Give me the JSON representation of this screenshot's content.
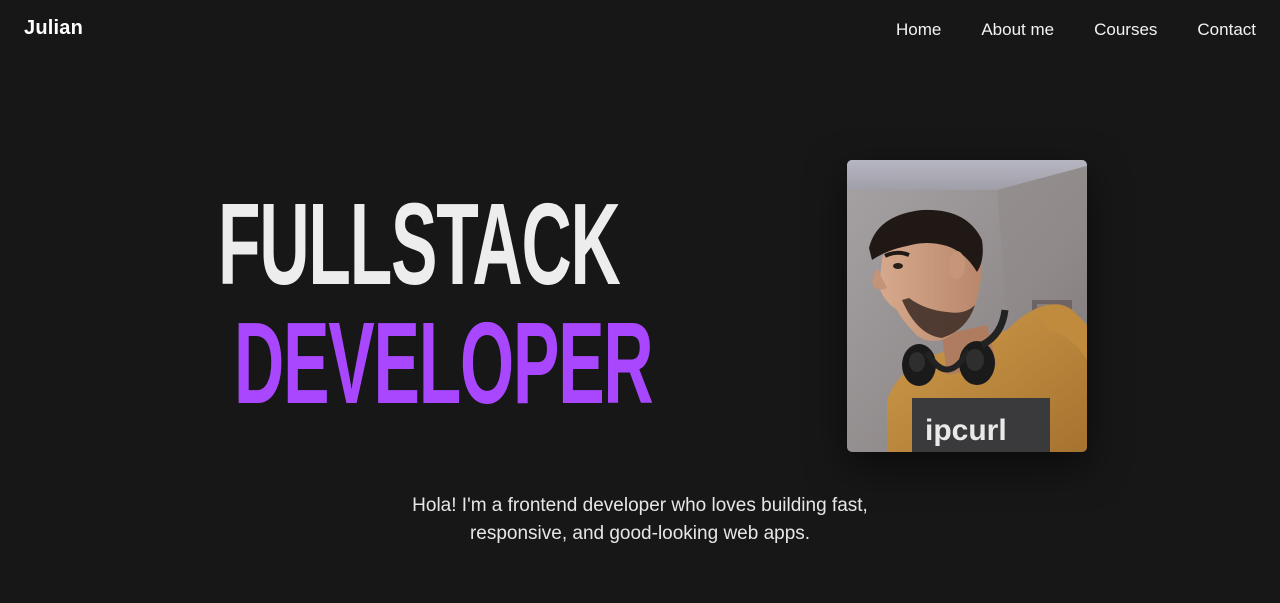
{
  "header": {
    "brand": "Julian",
    "nav": [
      {
        "label": "Home"
      },
      {
        "label": "About me"
      },
      {
        "label": "Courses"
      },
      {
        "label": "Contact"
      }
    ]
  },
  "hero": {
    "title_line_1": "FULLSTACK",
    "title_line_2": "DEVELOPER",
    "accent_color": "#a947ff",
    "intro_line_1": "Hola! I'm a frontend developer who loves building fast,",
    "intro_line_2": "responsive, and good-looking web apps.",
    "photo_text": "ipcurl"
  },
  "theme": {
    "background": "#171717",
    "text": "#ededed"
  }
}
